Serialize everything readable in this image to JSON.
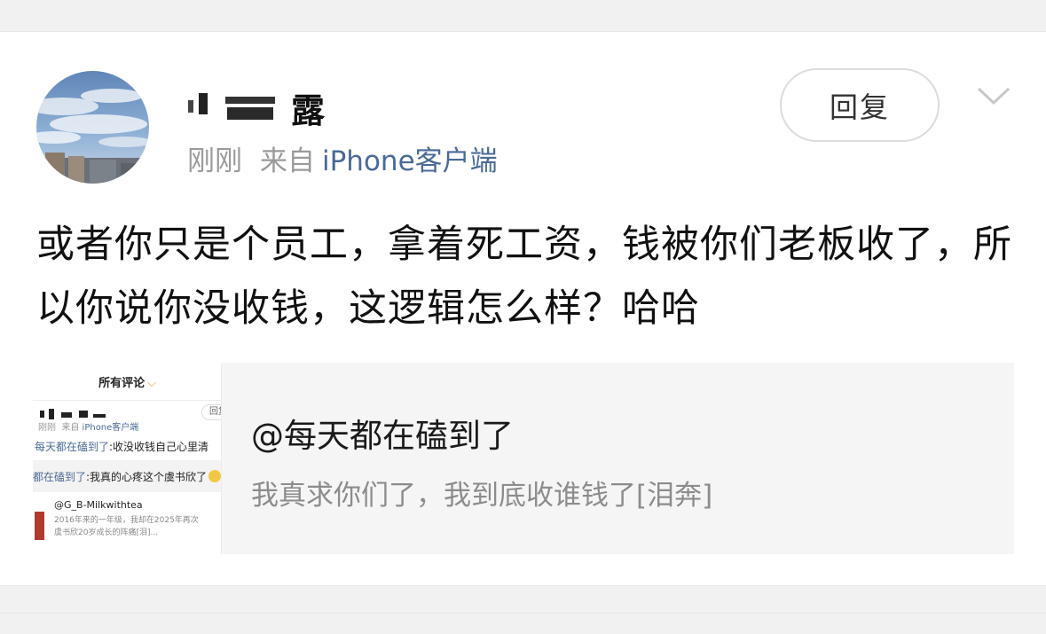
{
  "post": {
    "user_name": "露",
    "time": "刚刚",
    "source_prefix": "来自",
    "source_client": "iPhone客户端",
    "reply_label": "回复",
    "icons": {
      "expand": "chevron-down-icon"
    },
    "body": "或者你只是个员工，拿着死工资，钱被你们老板收了，所以你说你没收钱，这逻辑怎么样？哈哈"
  },
  "quote": {
    "title": "@每天都在磕到了",
    "text": "我真求你们了，我到底收谁钱了[泪奔]",
    "thumbnail": {
      "header": "所有评论",
      "reply_label": "回复",
      "meta_time": "刚刚",
      "meta_from": "来自",
      "meta_client": "iPhone客户端",
      "line1_mention": "每天都在磕到了",
      "line1_text": ":收没收钱自己心里清",
      "line2_mention": "都在磕到了",
      "line2_text": ":我真的心疼这个虞书欣了",
      "commenter": "@G_B-Milkwithtea",
      "comment_line1": "2016年来的一年级，我却在2025年再次",
      "comment_line2": "虞书欣20岁成长的阵痛[泪]..."
    }
  },
  "colors": {
    "link": "#4a6a98",
    "muted": "#9a9a9a",
    "quote_bg": "#f5f5f5",
    "band_bg": "#f1f1f1"
  }
}
